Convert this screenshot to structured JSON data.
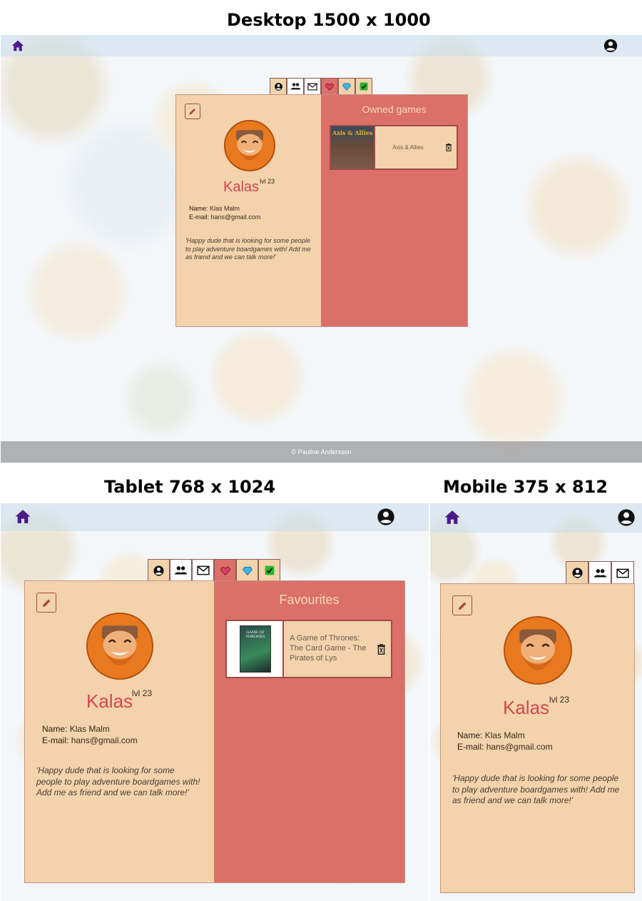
{
  "headings": {
    "desktop": "Desktop 1500 x 1000",
    "tablet": "Tablet 768 x 1024",
    "mobile": "Mobile 375 x 812"
  },
  "profile": {
    "username": "Kalas",
    "level": "lvl 23",
    "name_label": "Name:",
    "name_value": "Klas  Malm",
    "email_label": "E-mail:",
    "email_value": "hans@gmail.com",
    "bio": "'Happy dude that is looking for some people to play adventure boardgames with! Add me as friend and we can talk more!'"
  },
  "desktop": {
    "panel_title": "Owned games",
    "game_title": "Axis & Allies",
    "thumb_label": "Axis & Allies",
    "footer": "© Pauline Andersson"
  },
  "tablet": {
    "panel_title": "Favourites",
    "game_title": "A Game of Thrones: The Card Game - The Pirates of Lys",
    "thumb_label": "GAME OF THRONES"
  },
  "colors": {
    "card_bg": "#f2d3ab",
    "panel_bg": "#db7069",
    "accent_name": "#d4464f",
    "nav_icon": "#4b1a8a"
  },
  "icons": {
    "nav": [
      "home-icon",
      "user-icon"
    ],
    "tabs": [
      "profile-icon",
      "friends-icon",
      "mail-icon",
      "heart-icon",
      "gem-icon",
      "check-icon"
    ]
  }
}
